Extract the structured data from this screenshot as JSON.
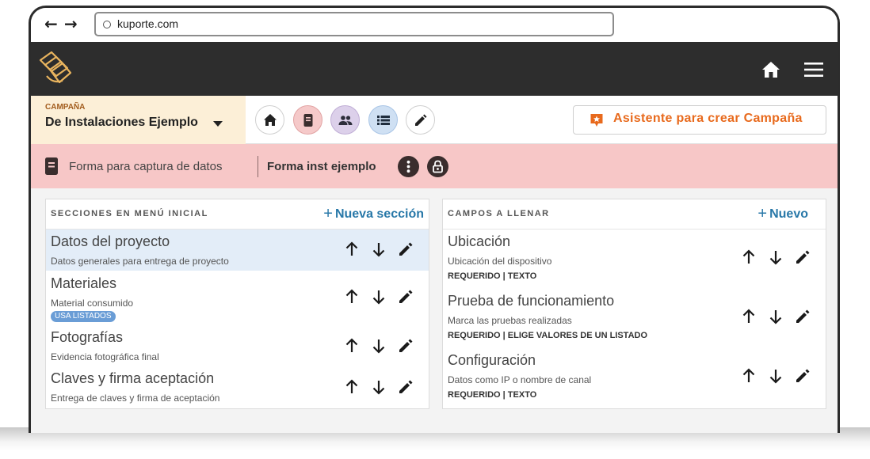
{
  "browser": {
    "url": "kuporte.com"
  },
  "campaign": {
    "label": "CAMPAÑA",
    "name": "De Instalaciones Ejemplo",
    "wizard_label": "Asistente para crear Campaña"
  },
  "form_bar": {
    "label": "Forma para captura de datos",
    "form_name": "Forma inst ejemplo"
  },
  "sections": {
    "title": "SECCIONES EN MENÚ INICIAL",
    "add_label": "Nueva sección",
    "items": [
      {
        "title": "Datos del proyecto",
        "subtitle": "Datos generales para entrega de proyecto"
      },
      {
        "title": "Materiales",
        "subtitle": "Material consumido",
        "badge": "USA LISTADOS"
      },
      {
        "title": "Fotografías",
        "subtitle": "Evidencia fotográfica final"
      },
      {
        "title": "Claves y firma aceptación",
        "subtitle": "Entrega de claves y firma de aceptación"
      }
    ]
  },
  "fields": {
    "title": "CAMPOS A LLENAR",
    "add_label": "Nuevo",
    "items": [
      {
        "title": "Ubicación",
        "subtitle": "Ubicación del dispositivo",
        "meta": "REQUERIDO | TEXTO"
      },
      {
        "title": "Prueba de funcionamiento",
        "subtitle": "Marca las pruebas realizadas",
        "meta": "REQUERIDO | ELIGE VALORES DE UN LISTADO"
      },
      {
        "title": "Configuración",
        "subtitle": "Datos como IP o nombre de canal",
        "meta": "REQUERIDO | TEXTO"
      }
    ]
  },
  "colors": {
    "header_bg": "#2d2d2d",
    "campaign_bg": "#fcefd7",
    "pink_bar": "#f7c7c7",
    "accent_orange": "#e86a1d",
    "link_blue": "#2878a8",
    "selected_row": "#e3edf8"
  },
  "icons": [
    "logo-icon",
    "home-icon",
    "menu-icon",
    "form-icon",
    "users-icon",
    "list-icon",
    "pencil-icon",
    "star-badge-icon",
    "more-vertical-icon",
    "lock-icon",
    "arrow-up-icon",
    "arrow-down-icon"
  ]
}
